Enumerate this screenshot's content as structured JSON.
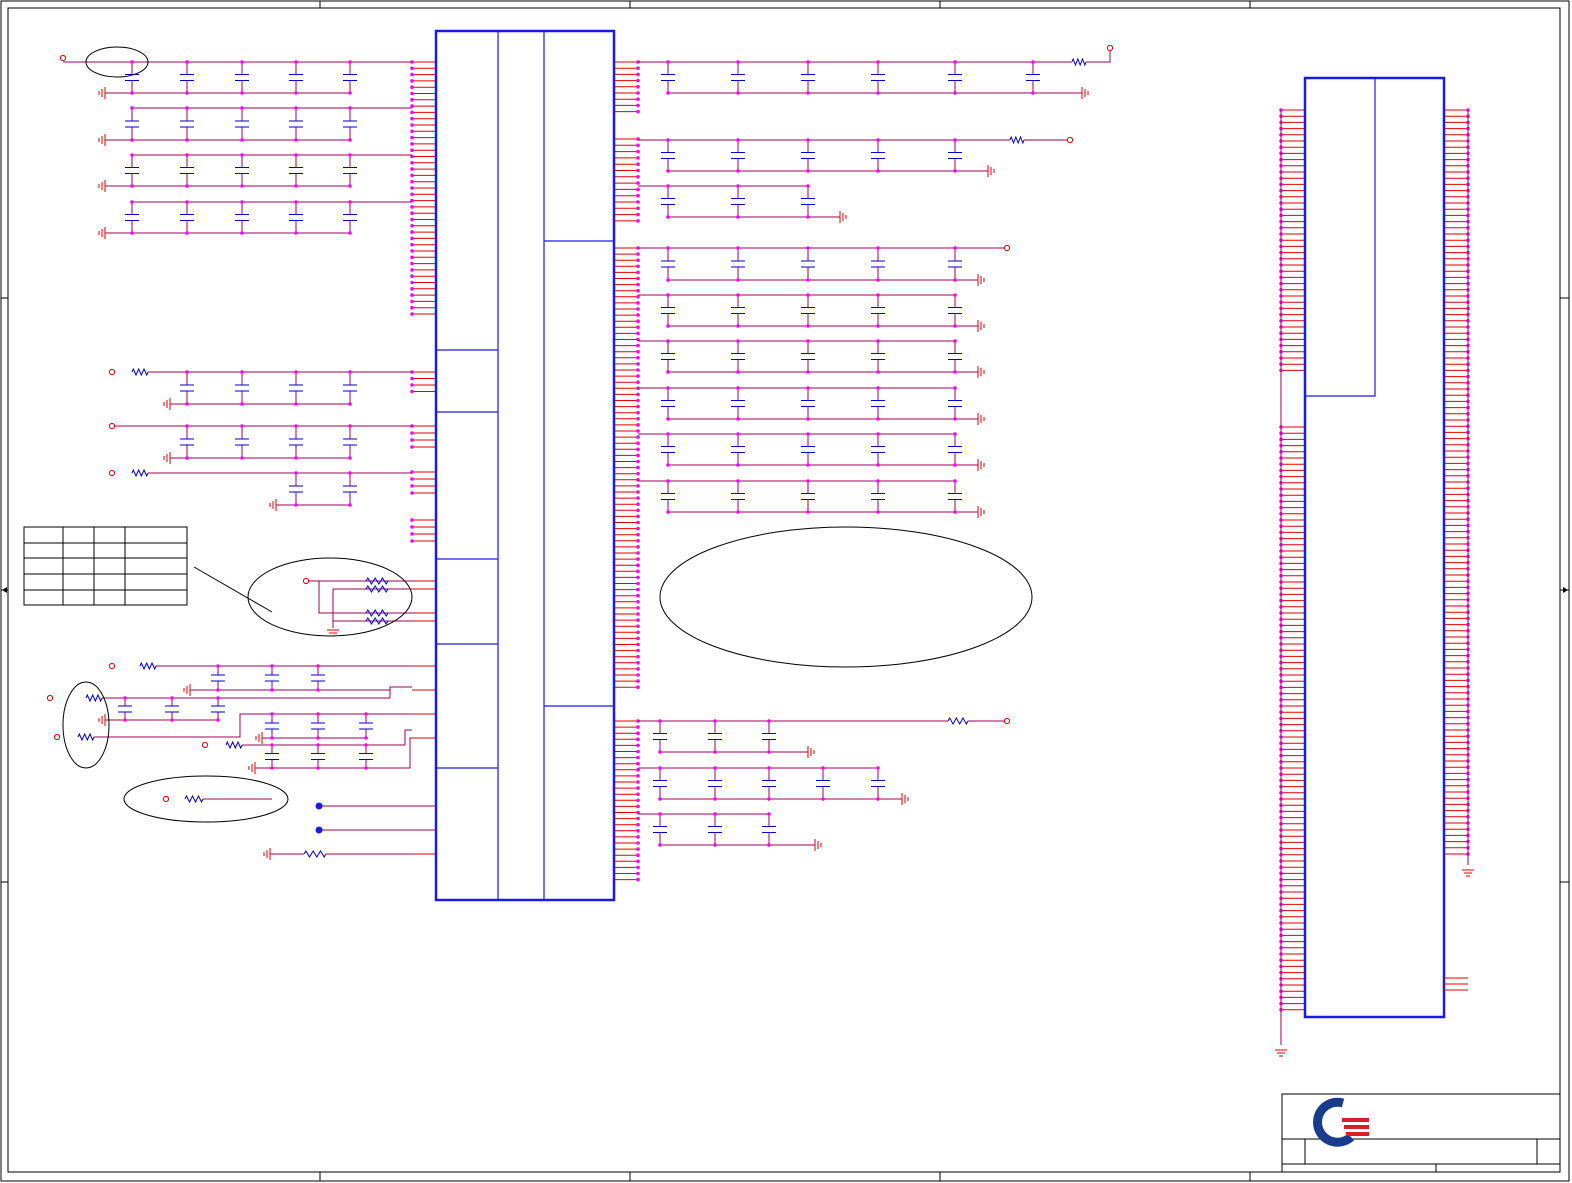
{
  "sheet": {
    "colors": {
      "wire": "#a0005a",
      "pin": "#e00000",
      "symbol": "#1a1ae6",
      "component": "#0000c8",
      "node": "#ff00ff",
      "frame": "#000000",
      "logo_blue": "#1a3c8c",
      "logo_red": "#d71f2b"
    },
    "logo": {
      "icon": "company-logo-q"
    }
  }
}
